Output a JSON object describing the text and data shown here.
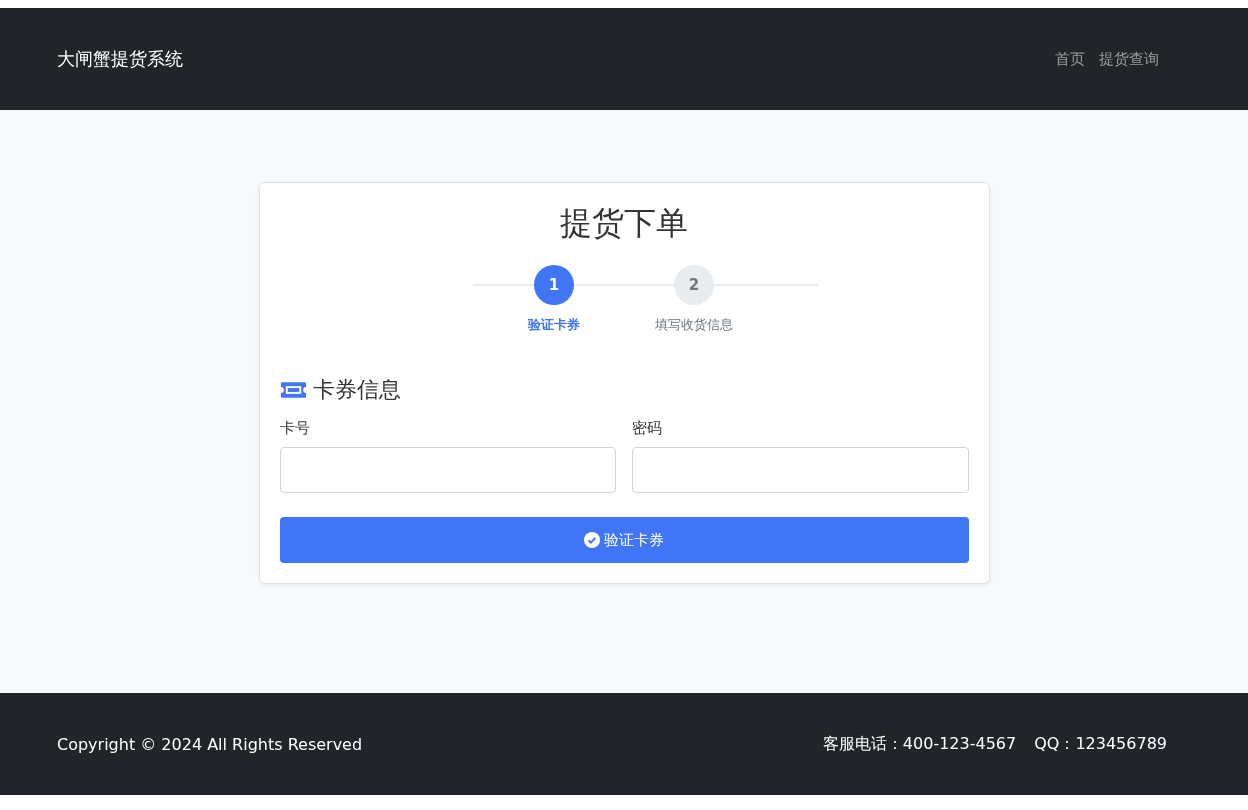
{
  "header": {
    "brand": "大闸蟹提货系统",
    "nav": [
      {
        "label": "首页"
      },
      {
        "label": "提货查询"
      }
    ]
  },
  "card": {
    "title": "提货下单",
    "steps": [
      {
        "number": "1",
        "label": "验证卡券",
        "selected": true
      },
      {
        "number": "2",
        "label": "填写收货信息",
        "selected": false
      }
    ],
    "section_title": "卡券信息",
    "fields": [
      {
        "label": "卡号"
      },
      {
        "label": "密码"
      }
    ],
    "submit": "验证卡券"
  },
  "footer": {
    "copyright": "Copyright © 2024 All Rights Reserved",
    "contacts": [
      "客服电话：400-123-4567",
      "QQ：123456789"
    ]
  }
}
